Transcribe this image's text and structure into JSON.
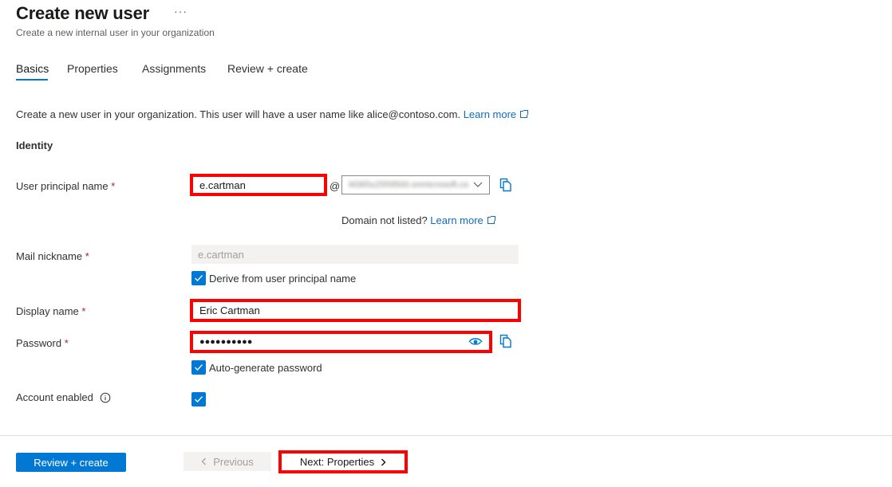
{
  "header": {
    "title": "Create new user",
    "more_label": "···",
    "subtitle": "Create a new internal user in your organization"
  },
  "tabs": [
    {
      "label": "Basics",
      "active": true
    },
    {
      "label": "Properties",
      "active": false
    },
    {
      "label": "Assignments",
      "active": false
    },
    {
      "label": "Review + create",
      "active": false
    }
  ],
  "intro": {
    "text": "Create a new user in your organization. This user will have a user name like alice@contoso.com.",
    "learn_more": "Learn more"
  },
  "section_title": "Identity",
  "fields": {
    "upn": {
      "label": "User principal name",
      "required_mark": "*",
      "value": "e.cartman",
      "at_sign": "@",
      "domain_value": "M365x2559500.onmicrosoft.com",
      "domain_hint": "Domain not listed?",
      "domain_learn_more": "Learn more"
    },
    "mail_nickname": {
      "label": "Mail nickname",
      "required_mark": "*",
      "value": "e.cartman",
      "derive_label": "Derive from user principal name",
      "derive_checked": true
    },
    "display_name": {
      "label": "Display name",
      "required_mark": "*",
      "value": "Eric Cartman"
    },
    "password": {
      "label": "Password",
      "required_mark": "*",
      "value": "●●●●●●●●●●",
      "autogen_label": "Auto-generate password",
      "autogen_checked": true
    },
    "account_enabled": {
      "label": "Account enabled",
      "checked": true
    }
  },
  "footer": {
    "review_create": "Review + create",
    "previous": "Previous",
    "next": "Next: Properties"
  },
  "colors": {
    "accent": "#0078d4",
    "highlight": "#ff0000",
    "link": "#0f6cbd",
    "required": "#a4262c"
  }
}
